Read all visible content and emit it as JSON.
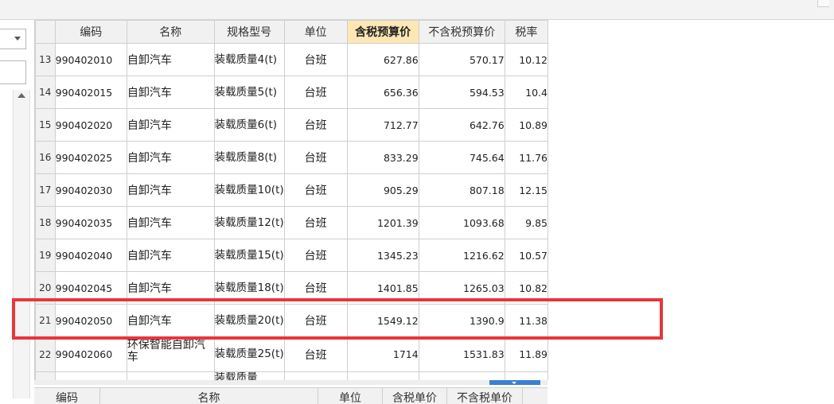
{
  "columns": [
    "编码",
    "名称",
    "规格型号",
    "单位",
    "含税预算价",
    "不含税预算价",
    "税率"
  ],
  "rows": [
    {
      "no": "13",
      "code": "990402010",
      "name": "自卸汽车",
      "spec": "装载质量4(t)",
      "unit": "台班",
      "price_tax": "627.86",
      "price_notax": "570.17",
      "rate": "10.12"
    },
    {
      "no": "14",
      "code": "990402015",
      "name": "自卸汽车",
      "spec": "装载质量5(t)",
      "unit": "台班",
      "price_tax": "656.36",
      "price_notax": "594.53",
      "rate": "10.4"
    },
    {
      "no": "15",
      "code": "990402020",
      "name": "自卸汽车",
      "spec": "装载质量6(t)",
      "unit": "台班",
      "price_tax": "712.77",
      "price_notax": "642.76",
      "rate": "10.89"
    },
    {
      "no": "16",
      "code": "990402025",
      "name": "自卸汽车",
      "spec": "装载质量8(t)",
      "unit": "台班",
      "price_tax": "833.29",
      "price_notax": "745.64",
      "rate": "11.76"
    },
    {
      "no": "17",
      "code": "990402030",
      "name": "自卸汽车",
      "spec": "装载质量10(t)",
      "unit": "台班",
      "price_tax": "905.29",
      "price_notax": "807.18",
      "rate": "12.15"
    },
    {
      "no": "18",
      "code": "990402035",
      "name": "自卸汽车",
      "spec": "装载质量12(t)",
      "unit": "台班",
      "price_tax": "1201.39",
      "price_notax": "1093.68",
      "rate": "9.85"
    },
    {
      "no": "19",
      "code": "990402040",
      "name": "自卸汽车",
      "spec": "装载质量15(t)",
      "unit": "台班",
      "price_tax": "1345.23",
      "price_notax": "1216.62",
      "rate": "10.57"
    },
    {
      "no": "20",
      "code": "990402045",
      "name": "自卸汽车",
      "spec": "装载质量18(t)",
      "unit": "台班",
      "price_tax": "1401.85",
      "price_notax": "1265.03",
      "rate": "10.82"
    },
    {
      "no": "21",
      "code": "990402050",
      "name": "自卸汽车",
      "spec": "装载质量20(t)",
      "unit": "台班",
      "price_tax": "1549.12",
      "price_notax": "1390.9",
      "rate": "11.38"
    },
    {
      "no": "22",
      "code": "990402060",
      "name": "环保智能自卸汽车",
      "spec": "装载质量25(t)",
      "unit": "台班",
      "price_tax": "1714",
      "price_notax": "1531.83",
      "rate": "11.89"
    },
    {
      "no": "",
      "code": "",
      "name": "",
      "spec": "装载质量",
      "unit": "",
      "price_tax": "",
      "price_notax": "",
      "rate": ""
    }
  ],
  "bottom_columns": [
    "编码",
    "名称",
    "单位",
    "含税单价",
    "不含税单价"
  ],
  "highlight_color": "#e8363a"
}
